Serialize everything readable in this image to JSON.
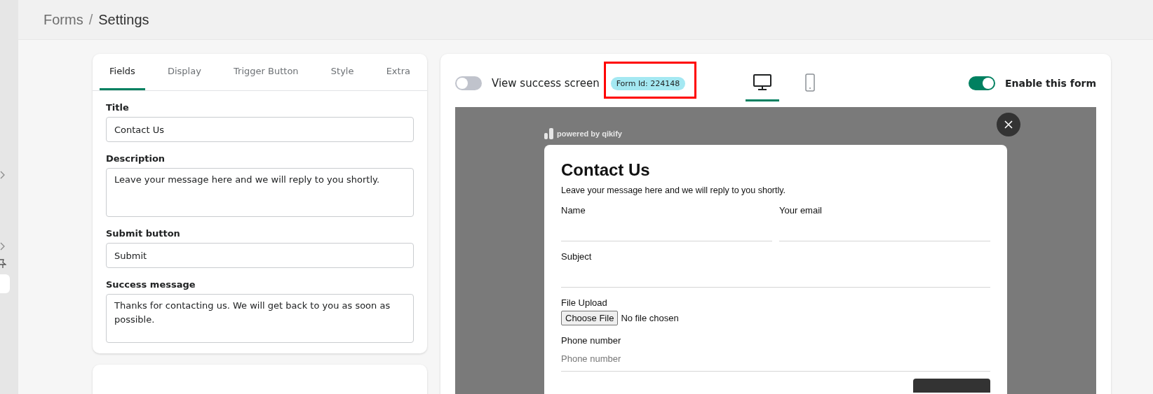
{
  "breadcrumb": [
    {
      "label": "Forms"
    },
    {
      "label": "Settings"
    }
  ],
  "breadcrumb_separator": "/",
  "tabs": [
    {
      "label": "Fields",
      "selected": true
    },
    {
      "label": "Display",
      "selected": false
    },
    {
      "label": "Trigger Button",
      "selected": false
    },
    {
      "label": "Style",
      "selected": false
    },
    {
      "label": "Extra",
      "selected": false
    }
  ],
  "settings_fields": [
    {
      "kind": "input",
      "label": "Title",
      "value": "Contact Us"
    },
    {
      "kind": "textarea",
      "label": "Description",
      "value": "Leave your message here and we will reply to you shortly."
    },
    {
      "kind": "input",
      "label": "Submit button",
      "value": "Submit"
    },
    {
      "kind": "textarea",
      "label": "Success message",
      "value": "Thanks for contacting us. We will get back to you as soon as possible."
    }
  ],
  "preview_toolbar": {
    "view_success_screen": {
      "label": "View success screen",
      "on": false
    },
    "form_id": "Form Id: 224148",
    "devices": [
      {
        "kind": "desktop",
        "selected": true
      },
      {
        "kind": "mobile",
        "selected": false
      }
    ],
    "enable_form": {
      "label": "Enable this form",
      "on": true
    }
  },
  "preview": {
    "powered_by": "powered by qikify",
    "title": "Contact Us",
    "description": "Leave your message here and we will reply to you shortly.",
    "rows": [
      {
        "fields": [
          {
            "kind": "text",
            "label": "Name"
          },
          {
            "kind": "text",
            "label": "Your email"
          }
        ]
      },
      {
        "fields": [
          {
            "kind": "text",
            "label": "Subject"
          }
        ]
      },
      {
        "fields": [
          {
            "kind": "file",
            "label": "File Upload",
            "button": "Choose File",
            "status": "No file chosen"
          }
        ]
      },
      {
        "fields": [
          {
            "kind": "text",
            "label": "Phone number",
            "placeholder": "Phone number"
          }
        ]
      }
    ]
  }
}
